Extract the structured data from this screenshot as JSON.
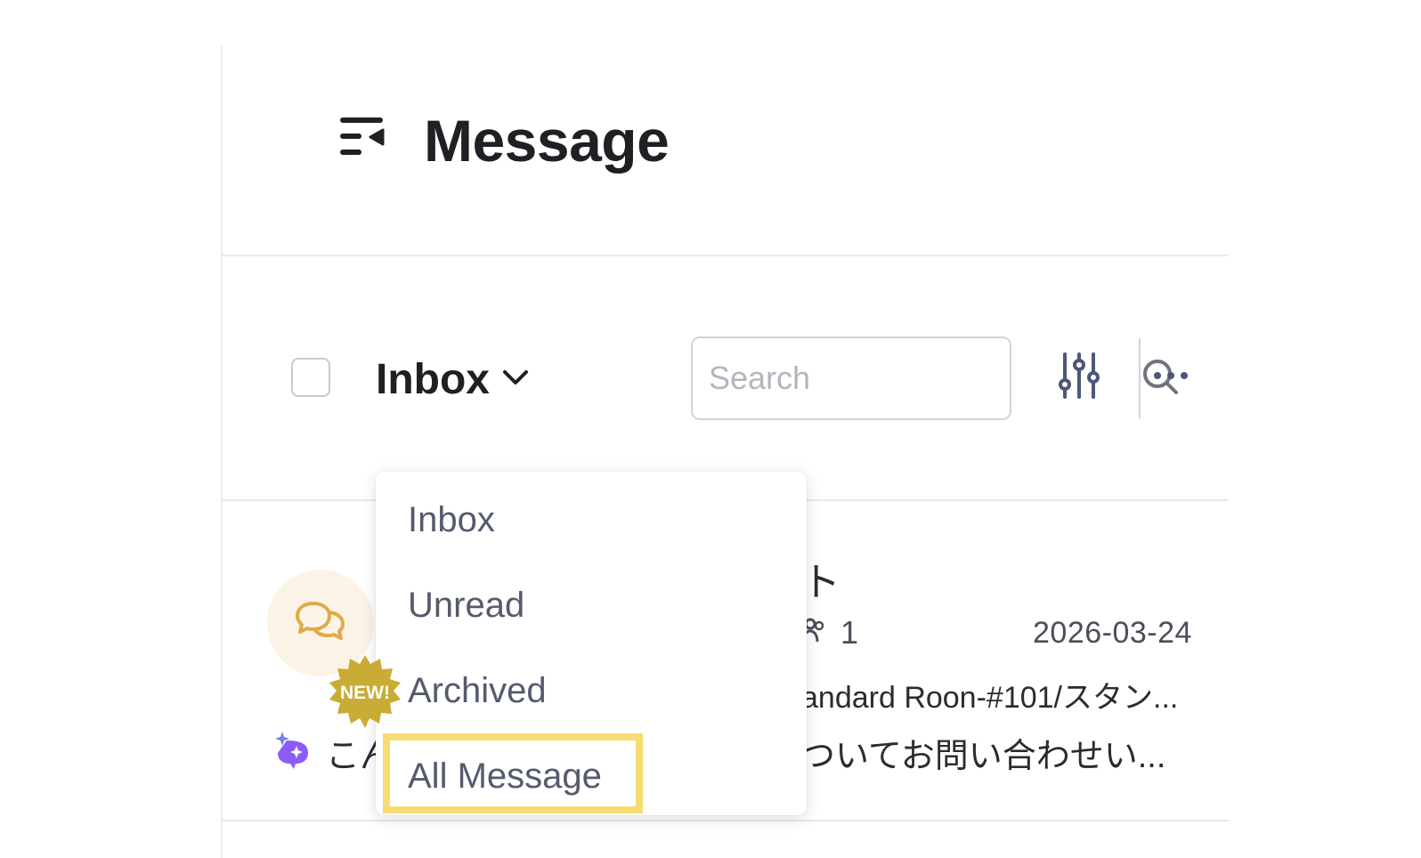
{
  "header": {
    "title": "Message",
    "menu_icon": "menu-collapse-icon"
  },
  "toolbar": {
    "folder_label": "Inbox",
    "search": {
      "placeholder": "Search",
      "value": ""
    },
    "icons": {
      "search": "search-icon",
      "filter": "sliders-icon",
      "more": "more-horizontal-icon",
      "dropdown": "chevron-down-icon"
    }
  },
  "dropdown": {
    "items": [
      {
        "label": "Inbox"
      },
      {
        "label": "Unread"
      },
      {
        "label": "Archived",
        "badge": "NEW!"
      },
      {
        "label": "All Message",
        "highlighted": true
      }
    ]
  },
  "conversation": {
    "name_partial": "ト",
    "guest_count": "1",
    "date": "2026-03-24",
    "room_partial": "andard Roon-#101/スタン...",
    "preview_start": "こん",
    "preview_partial": "ついてお問い合わせい...",
    "avatar_icon": "chat-bubbles-icon",
    "ai_icon": "ai-sparkle-icon"
  },
  "colors": {
    "accent_highlight": "#f6dc73",
    "badge": "#c9ac35",
    "avatar_bg": "#fbf4e6",
    "avatar_icon": "#e0a94a",
    "ai_icon": "#8b5cf6"
  }
}
